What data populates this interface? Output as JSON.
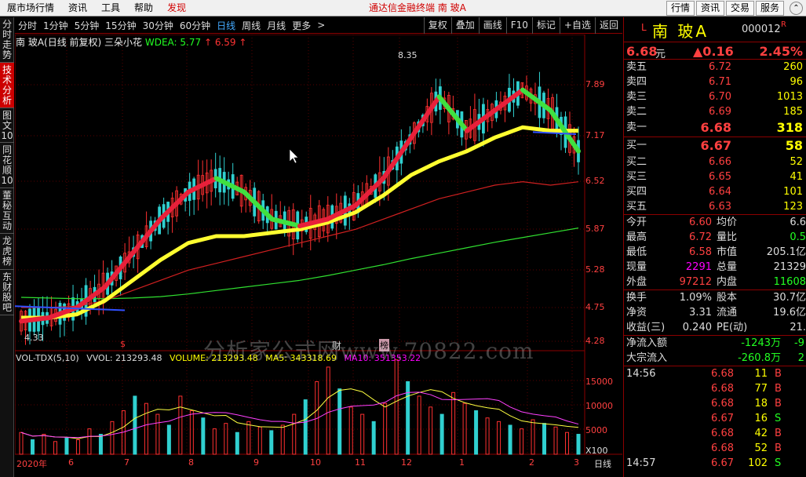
{
  "menu": {
    "items": [
      "展市场行情",
      "资讯",
      "工具",
      "帮助",
      "发现"
    ],
    "center_title": "通达信金融终端   南 玻A",
    "right_buttons": [
      "行情",
      "资讯",
      "交易",
      "服务"
    ]
  },
  "side_tabs": [
    "分时走势",
    "技术分析",
    "图文10",
    "同花顺10",
    "董秘互动",
    "龙虎榜",
    "东财股吧"
  ],
  "toolbar": {
    "periods": [
      "分时",
      "1分钟",
      "5分钟",
      "15分钟",
      "30分钟",
      "60分钟",
      "日线",
      "周线",
      "月线",
      "更多",
      ">"
    ],
    "active_period": "日线",
    "right_buttons": [
      "复权",
      "叠加",
      "画线",
      "F10",
      "标记",
      "+自选",
      "返回"
    ]
  },
  "chart_title": {
    "name": "南 玻A(日线 前复权) 三朵小花",
    "wdea": "WDEA: 5.77",
    "val2": "6.59",
    "arrow": "↑"
  },
  "volume_title": {
    "vol": "VOL-TDX(5,10)",
    "vvol": "VVOL: 213293.48",
    "volume": "VOLUME: 213293.48",
    "ma5": "MA5: 343318.69",
    "ma10": "MA10: 351353.22"
  },
  "watermark": "分析家公式网www.70822.com",
  "annotations": {
    "high": "8.35",
    "low": "4.33",
    "marker_s": "$",
    "marker_cai": "财",
    "marker_bang": "榜"
  },
  "chart_data": {
    "type": "line",
    "price_axis_ticks": [
      "7.89",
      "7.17",
      "6.52",
      "5.87",
      "5.28",
      "4.75",
      "4.28"
    ],
    "volume_axis_ticks": [
      "15000",
      "10000",
      "5000",
      "X100"
    ],
    "x_labels": [
      "2020年",
      "6",
      "7",
      "8",
      "9",
      "10",
      "11",
      "12",
      "1",
      "2",
      "3"
    ],
    "period_label": "日线",
    "high": 8.35,
    "low": 4.33,
    "series": [
      {
        "name": "WDEA",
        "values": [
          4.5,
          4.55,
          4.7,
          5.0,
          5.5,
          6.0,
          6.4,
          6.6,
          6.4,
          6.0,
          5.9,
          6.0,
          6.2,
          6.6,
          7.2,
          7.8,
          7.3,
          7.6,
          7.9,
          7.6,
          7.0
        ]
      },
      {
        "name": "MA-yellow",
        "values": [
          4.55,
          4.55,
          4.6,
          4.8,
          5.1,
          5.4,
          5.65,
          5.75,
          5.75,
          5.8,
          5.85,
          5.95,
          6.1,
          6.35,
          6.65,
          6.85,
          7.0,
          7.2,
          7.35,
          7.3,
          7.3
        ]
      },
      {
        "name": "MA-red",
        "values": [
          4.7,
          4.7,
          4.72,
          4.8,
          4.95,
          5.1,
          5.25,
          5.35,
          5.45,
          5.55,
          5.65,
          5.75,
          5.85,
          6.0,
          6.15,
          6.3,
          6.4,
          6.5,
          6.55,
          6.5,
          6.55
        ]
      },
      {
        "name": "MA-green",
        "values": [
          4.85,
          4.84,
          4.83,
          4.83,
          4.84,
          4.86,
          4.9,
          4.95,
          5.0,
          5.05,
          5.1,
          5.17,
          5.25,
          5.33,
          5.42,
          5.5,
          5.58,
          5.66,
          5.73,
          5.8,
          5.87
        ]
      }
    ],
    "volume": [
      60,
      40,
      55,
      35,
      45,
      40,
      70,
      55,
      90,
      120,
      160,
      140,
      110,
      80,
      160,
      120,
      100,
      70,
      85,
      60,
      90,
      75,
      65,
      80,
      110,
      150,
      200,
      240,
      180,
      130,
      110,
      90,
      140,
      260,
      200,
      160,
      130,
      110,
      170,
      140,
      120,
      100,
      90,
      80,
      70,
      95,
      85,
      75,
      60,
      55
    ]
  },
  "quote": {
    "L": "L",
    "name": "南 玻A",
    "code": "000012",
    "R": "R",
    "price": "6.68",
    "price_unit": "元",
    "change": "▲0.16",
    "pct": "2.45%",
    "asks": [
      {
        "label": "卖五",
        "price": "6.72",
        "vol": "260"
      },
      {
        "label": "卖四",
        "price": "6.71",
        "vol": "96"
      },
      {
        "label": "卖三",
        "price": "6.70",
        "vol": "1013"
      },
      {
        "label": "卖二",
        "price": "6.69",
        "vol": "185"
      },
      {
        "label": "卖一",
        "price": "6.68",
        "vol": "318"
      }
    ],
    "bids": [
      {
        "label": "买一",
        "price": "6.67",
        "vol": "58"
      },
      {
        "label": "买二",
        "price": "6.66",
        "vol": "52"
      },
      {
        "label": "买三",
        "price": "6.65",
        "vol": "41"
      },
      {
        "label": "买四",
        "price": "6.64",
        "vol": "101"
      },
      {
        "label": "买五",
        "price": "6.63",
        "vol": "123"
      }
    ],
    "stats": [
      {
        "k1": "今开",
        "v1": "6.60",
        "k2": "均价",
        "v2": "6.6"
      },
      {
        "k1": "最高",
        "v1": "6.72",
        "k2": "量比",
        "v2": "0.5"
      },
      {
        "k1": "最低",
        "v1": "6.58",
        "k2": "市值",
        "v2": "205.1亿"
      },
      {
        "k1": "现量",
        "v1": "2291",
        "k2": "总量",
        "v2": "21329"
      },
      {
        "k1": "外盘",
        "v1": "97212",
        "k2": "内盘",
        "v2": "11608"
      }
    ],
    "fund": [
      {
        "k1": "换手",
        "v1": "1.09%",
        "k2": "股本",
        "v2": "30.7亿"
      },
      {
        "k1": "净资",
        "v1": "3.31",
        "k2": "流通",
        "v2": "19.6亿"
      },
      {
        "k1": "收益(三)",
        "v1": "0.240",
        "k2": "PE(动)",
        "v2": "21."
      }
    ],
    "flows": [
      {
        "k": "净流入额",
        "v": "-1243万",
        "v2": "-9"
      },
      {
        "k": "大宗流入",
        "v": "-260.8万",
        "v2": "2"
      }
    ],
    "ticks": [
      {
        "t": "14:56",
        "p": "6.68",
        "v": "11",
        "bs": "B"
      },
      {
        "t": "",
        "p": "6.68",
        "v": "77",
        "bs": "B"
      },
      {
        "t": "",
        "p": "6.68",
        "v": "18",
        "bs": "B"
      },
      {
        "t": "",
        "p": "6.67",
        "v": "16",
        "bs": "S"
      },
      {
        "t": "",
        "p": "6.68",
        "v": "42",
        "bs": "B"
      },
      {
        "t": "",
        "p": "6.68",
        "v": "52",
        "bs": "B"
      },
      {
        "t": "14:57",
        "p": "6.67",
        "v": "102",
        "bs": "S"
      }
    ]
  }
}
